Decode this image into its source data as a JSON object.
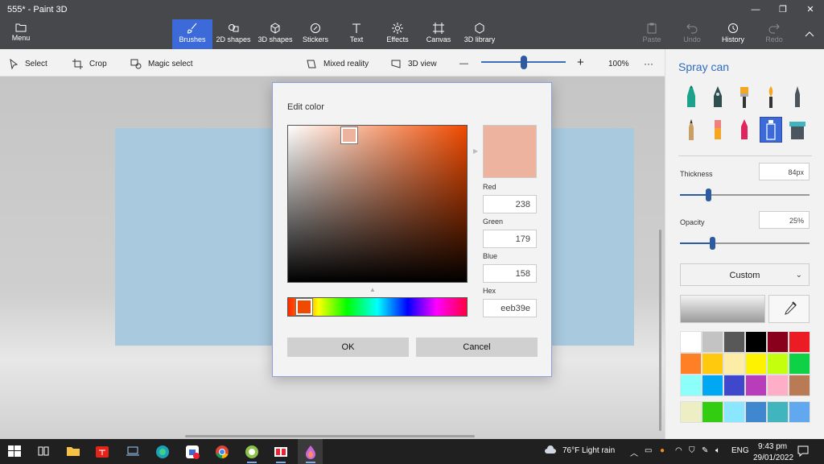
{
  "window": {
    "title": "555* - Paint 3D",
    "minimize": "—",
    "maximize": "❐",
    "close": "✕"
  },
  "ribbon": {
    "menu": "Menu",
    "tabs": [
      "Brushes",
      "2D shapes",
      "3D shapes",
      "Stickers",
      "Text",
      "Effects",
      "Canvas",
      "3D library"
    ],
    "right": {
      "paste": "Paste",
      "undo": "Undo",
      "history": "History",
      "redo": "Redo"
    }
  },
  "toolbar": {
    "select": "Select",
    "crop": "Crop",
    "magic_select": "Magic select",
    "mixed_reality": "Mixed reality",
    "view_3d": "3D view",
    "zoom_minus": "—",
    "zoom_plus": "+",
    "zoom_level": "100%",
    "more": "···",
    "zoom_fraction": 0.5
  },
  "dialog": {
    "title": "Edit color",
    "red_label": "Red",
    "red": "238",
    "green_label": "Green",
    "green": "179",
    "blue_label": "Blue",
    "blue": "158",
    "hex_label": "Hex",
    "hex": "eeb39e",
    "preview_color": "#eeb39e",
    "ok": "OK",
    "cancel": "Cancel"
  },
  "panel": {
    "title": "Spray can",
    "thickness_label": "Thickness",
    "thickness": "84px",
    "thickness_fraction": 0.22,
    "opacity_label": "Opacity",
    "opacity": "25%",
    "opacity_fraction": 0.25,
    "custom": "Custom",
    "brushes": [
      "marker",
      "calligraphy-pen",
      "oil-brush",
      "watercolor",
      "pixel-pen",
      "pencil",
      "eraser",
      "crayon",
      "spray-can",
      "fill"
    ],
    "swatches": [
      "#ffffff",
      "#c3c3c3",
      "#585858",
      "#000000",
      "#88001b",
      "#ec1c24",
      "#ff7f27",
      "#ffc90e",
      "#fdeca6",
      "#fff200",
      "#c4ff0e",
      "#0ed145",
      "#8cfffb",
      "#00a8f3",
      "#3f48cc",
      "#b83dba",
      "#ffaec8",
      "#b97a56",
      "#eeeec4",
      "#32cd10",
      "#8be7ff",
      "#3f88cf",
      "#40b5bd",
      "#61a8ee"
    ]
  },
  "taskbar": {
    "weather": "76°F  Light rain",
    "lang": "ENG",
    "time": "9:43 pm",
    "date": "29/01/2022"
  }
}
